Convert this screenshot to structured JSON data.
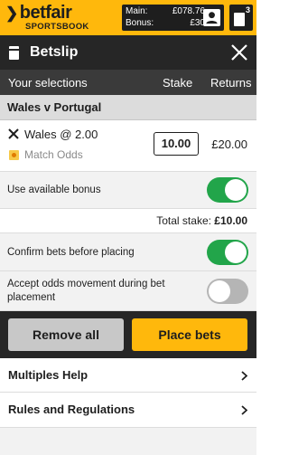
{
  "brand": {
    "name": "betfair",
    "sub": "SPORTSBOOK",
    "accent": "#ffb80c"
  },
  "account": {
    "main_label": "Main:",
    "main_value": "£078.76",
    "bonus_label": "Bonus:",
    "bonus_value": "£30",
    "icon": "user-icon"
  },
  "betslip_count": "3",
  "betslip": {
    "title": "Betslip",
    "close_icon": "close-icon"
  },
  "columns": {
    "selections": "Your selections",
    "stake": "Stake",
    "returns": "Returns"
  },
  "event": {
    "name": "Wales v Portugal"
  },
  "bet": {
    "selection": "Wales @ 2.00",
    "market": "Match Odds",
    "stake": "10.00",
    "returns": "£20.00"
  },
  "options": {
    "use_bonus": {
      "label": "Use available bonus",
      "on": true
    },
    "confirm": {
      "label": "Confirm bets before placing",
      "on": true
    },
    "accept_odds": {
      "label": "Accept odds movement during bet placement",
      "on": false
    }
  },
  "total": {
    "label": "Total stake:",
    "value": "£10.00"
  },
  "buttons": {
    "remove": "Remove all",
    "place": "Place bets"
  },
  "links": {
    "multiples": "Multiples Help",
    "rules": "Rules and Regulations"
  },
  "colors": {
    "toggle_on": "#22a54a",
    "toggle_off": "#b5b5b5",
    "header_dark": "#262626"
  }
}
